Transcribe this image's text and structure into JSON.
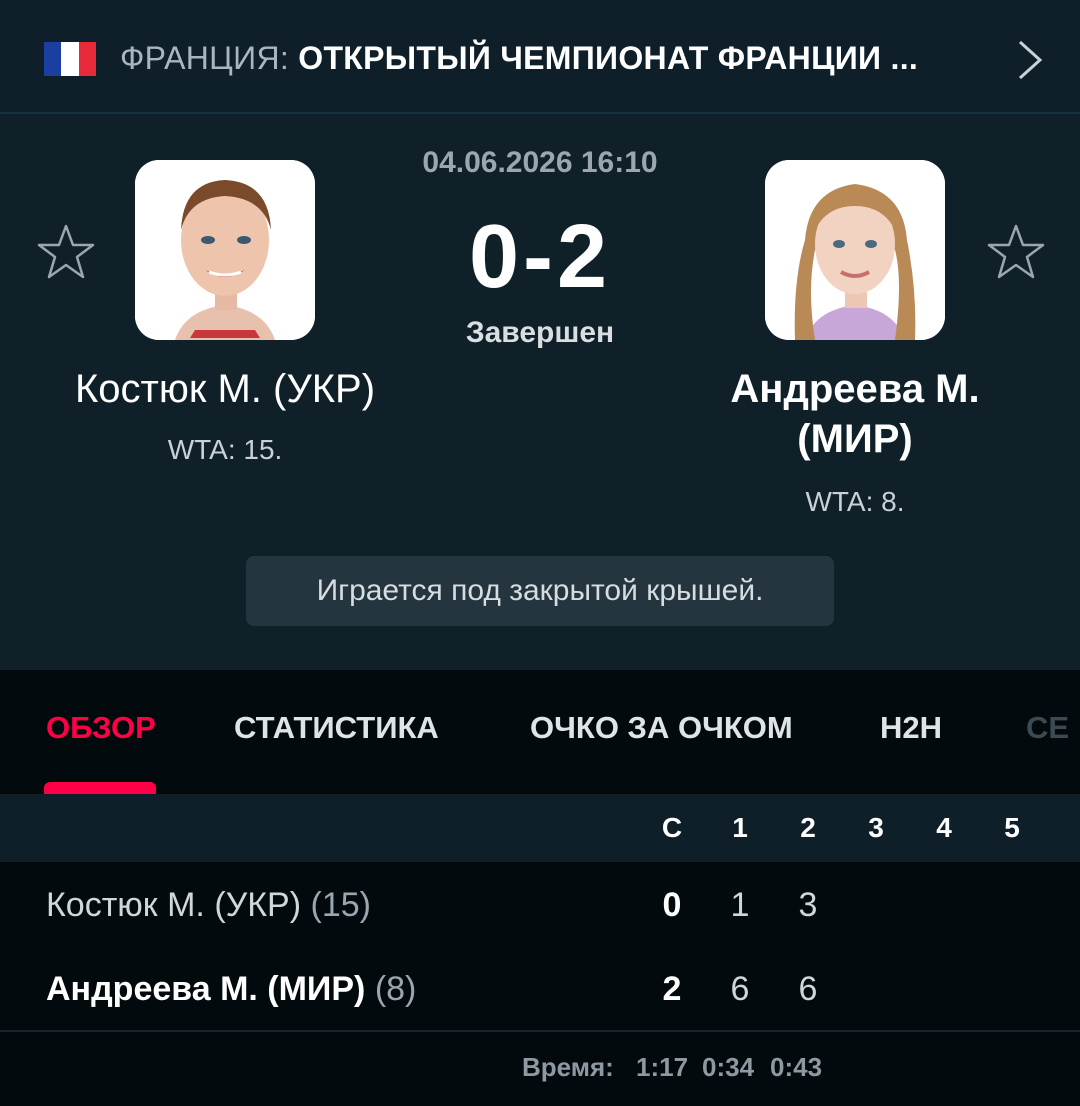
{
  "tournament": {
    "country": "ФРАНЦИЯ:",
    "name": "ОТКРЫТЫЙ ЧЕМПИОНАТ ФРАНЦИИ ...",
    "flag_colors": [
      "#1b3fa0",
      "#ffffff",
      "#e8293a"
    ]
  },
  "match": {
    "datetime": "04.06.2026 16:10",
    "score": "0-2",
    "status": "Завершен",
    "note": "Играется под закрытой крышей."
  },
  "players": [
    {
      "name": "Костюк М. (УКР)",
      "rank": "WTA: 15.",
      "photo_icon": "player-photo"
    },
    {
      "name_line1": "Андреева М.",
      "name_line2": "(МИР)",
      "rank": "WTA: 8.",
      "photo_icon": "player-photo"
    }
  ],
  "tabs": [
    "ОБЗОР",
    "СТАТИСТИКА",
    "ОЧКО ЗА ОЧКОМ",
    "H2H",
    "СЕ"
  ],
  "active_tab": 0,
  "scoreboard": {
    "headers": [
      "С",
      "1",
      "2",
      "3",
      "4",
      "5"
    ],
    "rows": [
      {
        "name": "Костюк М. (УКР)",
        "seed": "(15)",
        "total": "0",
        "sets": [
          "1",
          "3"
        ]
      },
      {
        "name": "Андреева М. (МИР)",
        "seed": "(8)",
        "total": "2",
        "sets": [
          "6",
          "6"
        ]
      }
    ],
    "time_label": "Время:",
    "times": [
      "1:17",
      "0:34",
      "0:43"
    ]
  },
  "colors": {
    "accent": "#ff0046",
    "background": "#0e1f2a",
    "tab_bar": "#030a0e"
  }
}
